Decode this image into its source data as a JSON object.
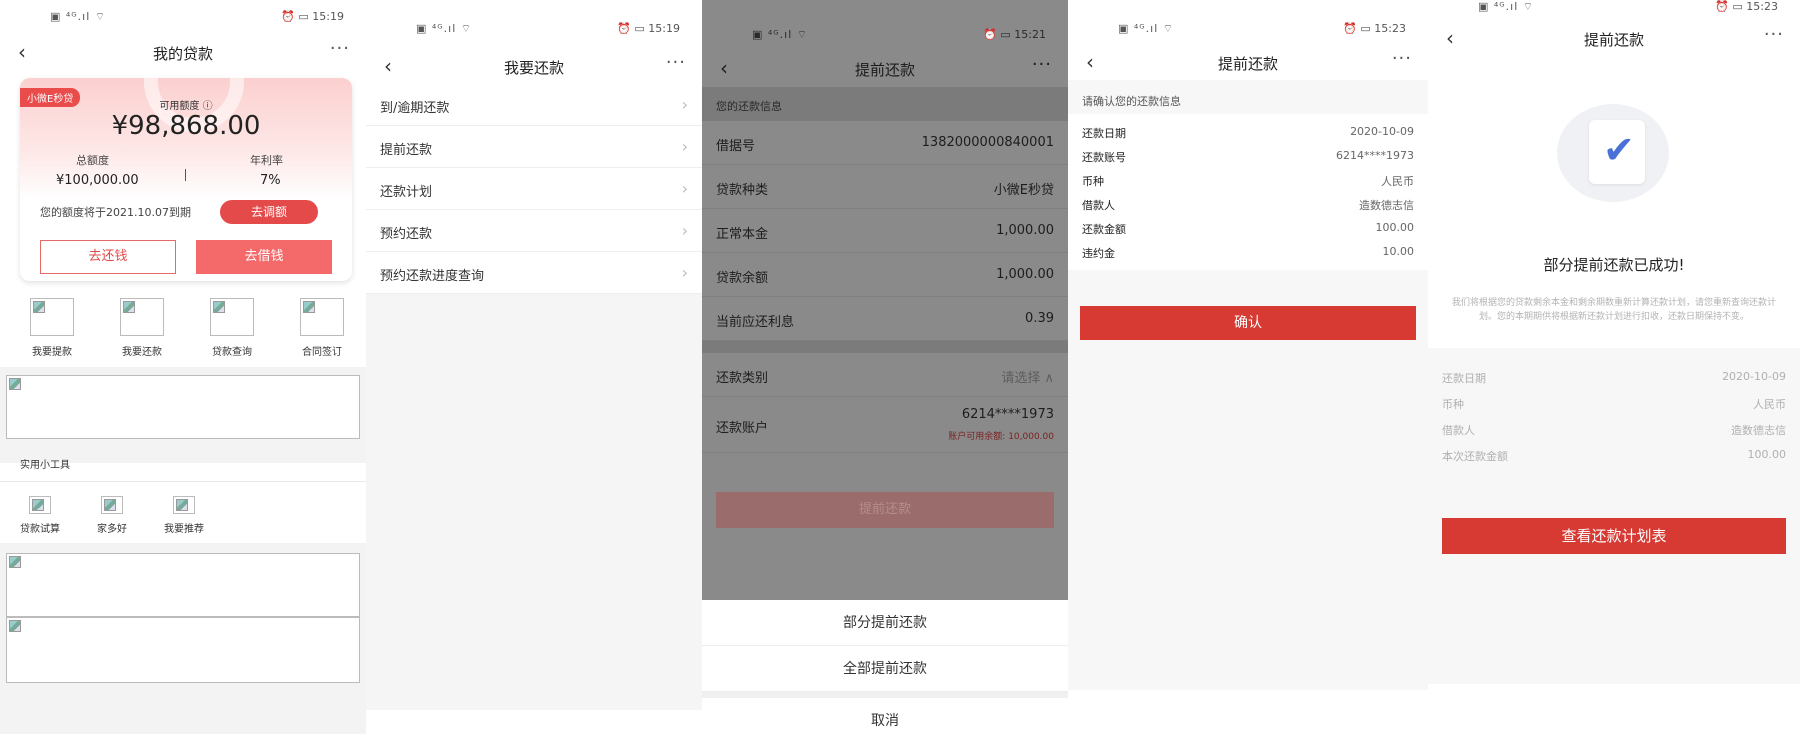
{
  "screen1": {
    "status": {
      "left": "▣ ⁴ᴳ.ıl ⌔",
      "right": "⏰ ▭ 15:19"
    },
    "title": "我的贷款",
    "card": {
      "product_badge": "小微E秒贷",
      "available_label": "可用额度",
      "available_value": "¥98,868.00",
      "total_label": "总额度",
      "total_value": "¥100,000.00",
      "rate_label": "年利率",
      "rate_value": "7%",
      "expiry_text": "您的额度将于2021.10.07到期",
      "adjust_button": "去调额",
      "repay_button": "去还钱",
      "borrow_button": "去借钱"
    },
    "quick_actions": [
      "我要提款",
      "我要还款",
      "贷款查询",
      "合同签订"
    ],
    "tools_title": "实用小工具",
    "tools": [
      "贷款试算",
      "家多好",
      "我要推荐"
    ]
  },
  "screen2": {
    "status": {
      "left": "▣ ⁴ᴳ.ıl ⌔",
      "right": "⏰ ▭ 15:19"
    },
    "title": "我要还款",
    "items": [
      "到/逾期还款",
      "提前还款",
      "还款计划",
      "预约还款",
      "预约还款进度查询"
    ]
  },
  "screen3": {
    "status": {
      "left": "▣ ⁴ᴳ.ıl ⌔",
      "right": "⏰ ▭ 15:21"
    },
    "title": "提前还款",
    "section_title": "您的还款信息",
    "rows": [
      {
        "label": "借据号",
        "value": "1382000000840001"
      },
      {
        "label": "贷款种类",
        "value": "小微E秒贷"
      },
      {
        "label": "正常本金",
        "value": "1,000.00"
      },
      {
        "label": "贷款余额",
        "value": "1,000.00"
      },
      {
        "label": "当前应还利息",
        "value": "0.39"
      }
    ],
    "type_label": "还款类别",
    "type_placeholder": "请选择",
    "account_label": "还款账户",
    "account_value": "6214****1973",
    "account_balance": "账户可用余额: 10,000.00",
    "submit_button": "提前还款",
    "sheet_options": [
      "部分提前还款",
      "全部提前还款"
    ],
    "sheet_cancel": "取消"
  },
  "screen4": {
    "status": {
      "left": "▣ ⁴ᴳ.ıl ⌔",
      "right": "⏰ ▭ 15:23"
    },
    "title": "提前还款",
    "subtitle": "请确认您的还款信息",
    "rows": [
      {
        "label": "还款日期",
        "value": "2020-10-09"
      },
      {
        "label": "还款账号",
        "value": "6214****1973"
      },
      {
        "label": "币种",
        "value": "人民币"
      },
      {
        "label": "借款人",
        "value": "造数德志信"
      },
      {
        "label": "还款金额",
        "value": "100.00"
      },
      {
        "label": "违约金",
        "value": "10.00"
      }
    ],
    "confirm_button": "确认"
  },
  "screen5": {
    "status": {
      "left": "▣ ⁴ᴳ.ıl ⌔",
      "right": "⏰ ▭ 15:23"
    },
    "title": "提前还款",
    "success_title": "部分提前还款已成功!",
    "success_desc": "我们将根据您的贷款剩余本金和剩余期数重新计算还款计划，请您重新查询还款计划。您的本期期供将根据新还款计划进行扣收，还款日期保持不变。",
    "rows": [
      {
        "label": "还款日期",
        "value": "2020-10-09"
      },
      {
        "label": "币种",
        "value": "人民币"
      },
      {
        "label": "借款人",
        "value": "造数德志信"
      },
      {
        "label": "本次还款金额",
        "value": "100.00"
      }
    ],
    "view_plan_button": "查看还款计划表"
  },
  "colors": {
    "primary_red": "#d63a33",
    "card_red": "#e44a4a",
    "check_blue": "#4a72d6"
  }
}
